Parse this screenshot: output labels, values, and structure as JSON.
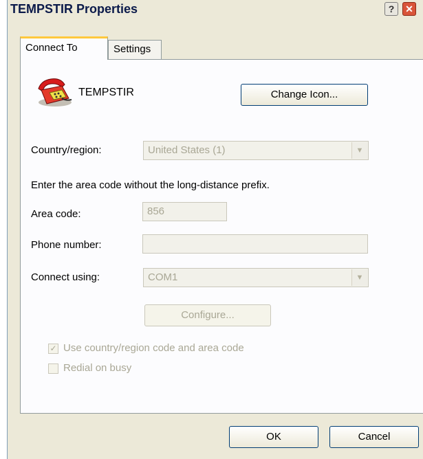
{
  "window": {
    "title": "TEMPSTIR Properties",
    "help_button": "?",
    "close_button": "✕"
  },
  "tabs": [
    {
      "label": "Connect To",
      "selected": true
    },
    {
      "label": "Settings",
      "selected": false
    }
  ],
  "connection": {
    "name": "TEMPSTIR",
    "icon": "telephone-icon",
    "change_icon_label": "Change Icon..."
  },
  "country_region": {
    "label": "Country/region:",
    "value": "United States (1)",
    "enabled": false
  },
  "instructions": "Enter the area code without the long-distance prefix.",
  "area_code": {
    "label": "Area code:",
    "value": "856",
    "enabled": false
  },
  "phone_number": {
    "label": "Phone number:",
    "value": "",
    "enabled": false
  },
  "connect_using": {
    "label": "Connect using:",
    "value": "COM1",
    "enabled": false
  },
  "configure_label": "Configure...",
  "options": [
    {
      "label": "Use country/region code and area code",
      "checked": true,
      "enabled": false
    },
    {
      "label": "Redial on busy",
      "checked": false,
      "enabled": false
    }
  ],
  "footer": {
    "ok_label": "OK",
    "cancel_label": "Cancel"
  },
  "colors": {
    "dialog_bg": "#ece9d8",
    "panel_bg": "#fcfcfe",
    "active_tab_accent": "#ffc83c",
    "disabled_text": "#a9a795",
    "button_border": "#003c74"
  }
}
